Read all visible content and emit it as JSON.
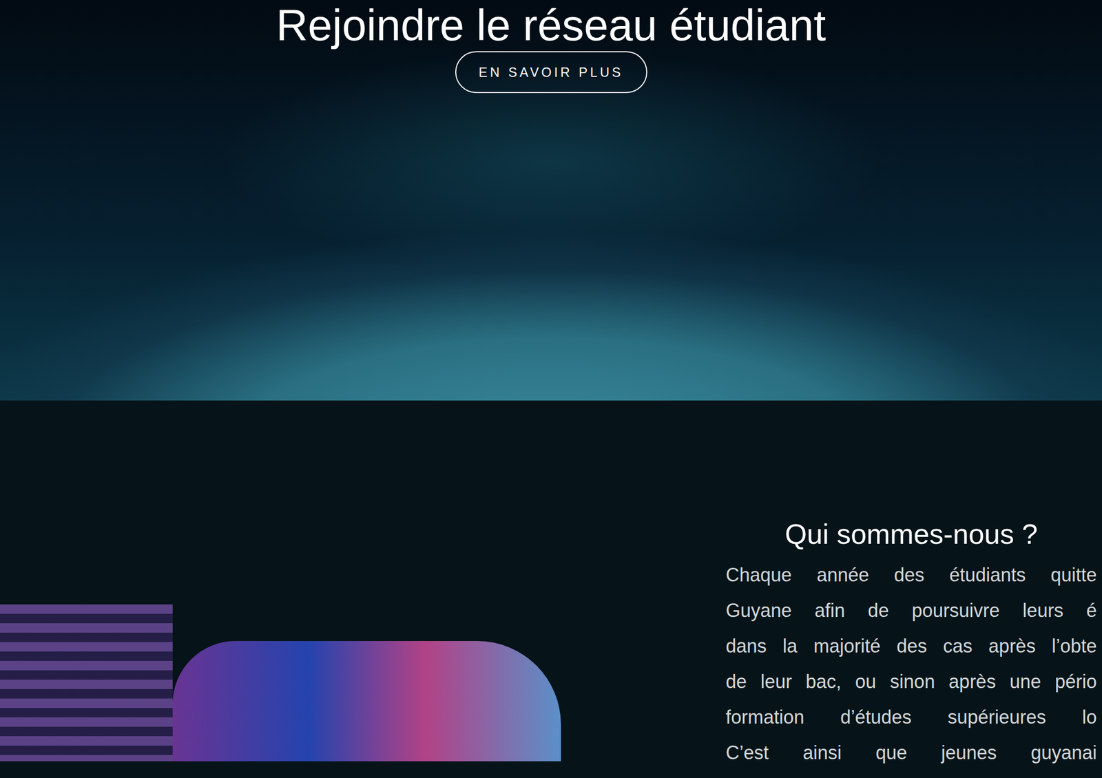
{
  "hero": {
    "title": "Rejoindre le réseau étudiant",
    "button": "EN SAVOIR PLUS"
  },
  "about": {
    "title": "Qui sommes-nous ?",
    "lines": [
      "Chaque année des étudiants quitte",
      "Guyane afin de poursuivre leurs é",
      "dans la majorité des cas après l’obte",
      "de leur bac, ou sinon après une pério",
      "formation d’études supérieures lo",
      "C’est ainsi que jeunes guyanai"
    ]
  }
}
